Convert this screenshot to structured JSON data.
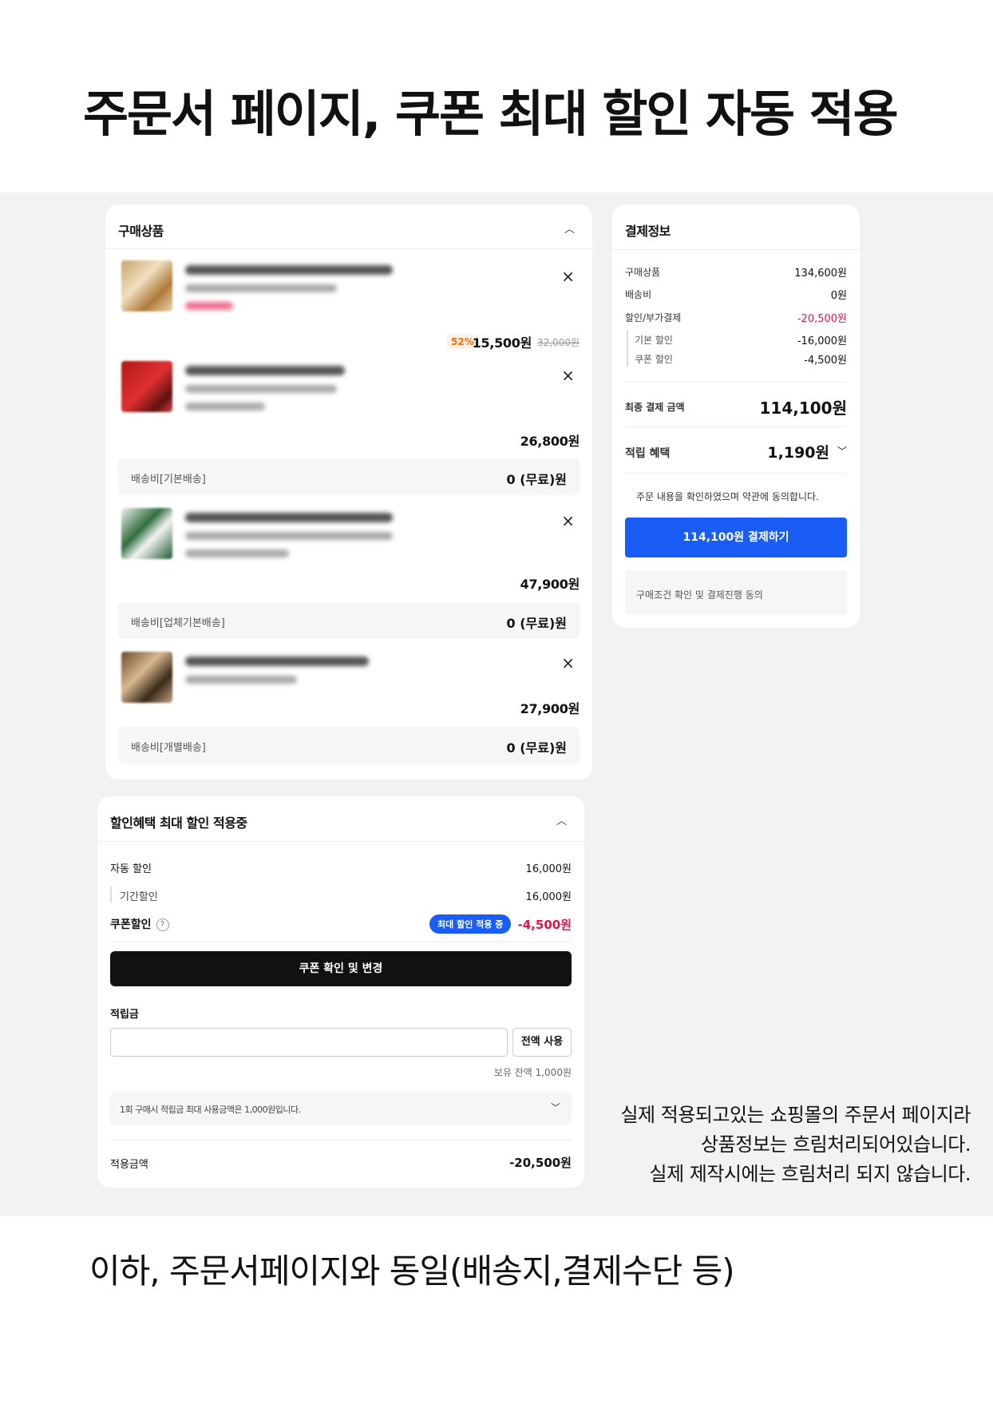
{
  "heading": "주문서 페이지, 쿠폰 최대 할인 자동 적용",
  "footer": "이하, 주문서페이지와 동일(배송지,결제수단 등)",
  "note": [
    "실제 적용되고있는 쇼핑몰의 주문서 페이지라",
    "상품정보는 흐림처리되어있습니다.",
    "실제 제작시에는 흐림처리 되지 않습니다."
  ],
  "products": {
    "title": "구매상품",
    "close_glyph": "×",
    "items": [
      {
        "discount_pct": "52%",
        "price": "15,500원",
        "orig_price": "32,000원"
      },
      {
        "price": "26,800원"
      },
      {
        "price": "47,900원"
      },
      {
        "price": "27,900원"
      }
    ],
    "shipping": [
      {
        "label": "배송비[기본배송]",
        "value": "0 (무료)원"
      },
      {
        "label": "배송비[업체기본배송]",
        "value": "0 (무료)원"
      },
      {
        "label": "배송비[개별배송]",
        "value": "0 (무료)원"
      }
    ]
  },
  "discount": {
    "title": "할인혜택 최대 할인 적용중",
    "auto_label": "자동 할인",
    "auto_value": "16,000원",
    "period_label": "기간할인",
    "period_value": "16,000원",
    "coupon_label": "쿠폰할인",
    "help_glyph": "?",
    "max_badge": "최대 할인 적용 중",
    "coupon_value": "-4,500원",
    "coupon_button": "쿠폰 확인 및 변경",
    "points_label": "적립금",
    "points_placeholder": "",
    "use_all": "전액 사용",
    "balance": "보유 잔액 1,000원",
    "info": "1회 구매시 적립금 최대 사용금액은 1,000원입니다.",
    "applied_label": "적용금액",
    "applied_value": "-20,500원"
  },
  "payment": {
    "title": "결제정보",
    "rows": [
      {
        "label": "구매상품",
        "value": "134,600원"
      },
      {
        "label": "배송비",
        "value": "0원"
      },
      {
        "label": "할인/부가결제",
        "value": "-20,500원"
      },
      {
        "label": "기본 할인",
        "value": "-16,000원"
      },
      {
        "label": "쿠폰 할인",
        "value": "-4,500원"
      }
    ],
    "final_label": "최종 결제 금액",
    "final_value": "114,100원",
    "reward_label": "적립 혜택",
    "reward_value": "1,190원",
    "agree_text": "주문 내용을 확인하였으며 약관에 동의합니다.",
    "pay_button": "114,100원 결제하기",
    "terms": "구매조건 확인 및 결제진행 동의"
  },
  "colors": {
    "accent_blue": "#1a5df5",
    "discount_red": "#e0144c",
    "discount_orange": "#ff6a00"
  }
}
